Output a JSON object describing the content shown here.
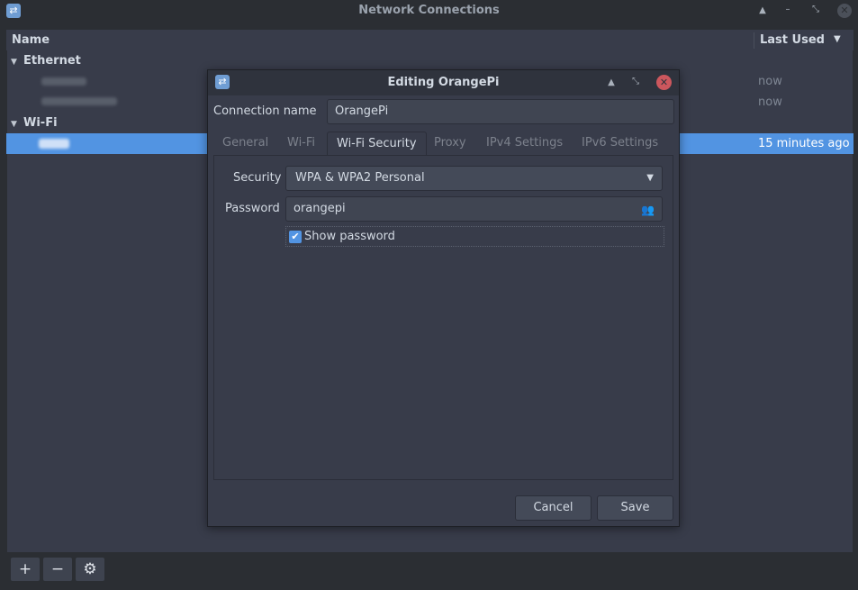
{
  "main_window": {
    "title": "Network Connections",
    "columns": {
      "name": "Name",
      "last_used": "Last Used"
    },
    "groups": [
      {
        "label": "Ethernet",
        "times": [
          "now",
          "now"
        ]
      },
      {
        "label": "Wi-Fi",
        "times": [
          "15 minutes ago"
        ]
      }
    ],
    "toolbar": {
      "add": "+",
      "remove": "−",
      "settings": "⚙"
    }
  },
  "dialog": {
    "title": "Editing OrangePi",
    "connection_name_label": "Connection name",
    "connection_name_value": "OrangePi",
    "tabs": [
      {
        "label": "General"
      },
      {
        "label": "Wi-Fi"
      },
      {
        "label": "Wi-Fi Security",
        "active": true
      },
      {
        "label": "Proxy"
      },
      {
        "label": "IPv4 Settings"
      },
      {
        "label": "IPv6 Settings"
      }
    ],
    "security_label": "Security",
    "security_value": "WPA & WPA2 Personal",
    "password_label": "Password",
    "password_value": "orangepi",
    "show_password_label": "Show password",
    "show_password_checked": true,
    "cancel_label": "Cancel",
    "save_label": "Save"
  },
  "icons": {
    "app": "network-connections-icon",
    "shade": "shade-icon",
    "minimize": "minimize-icon",
    "maximize": "maximize-icon",
    "close": "close-icon",
    "dropdown": "chevron-down-icon",
    "password_storage": "users-icon",
    "checkbox": "checkmark-icon"
  },
  "colors": {
    "accent": "#5294e2",
    "background": "#383c4a",
    "window_frame": "#2b2e33",
    "close_button": "#cc575d"
  }
}
